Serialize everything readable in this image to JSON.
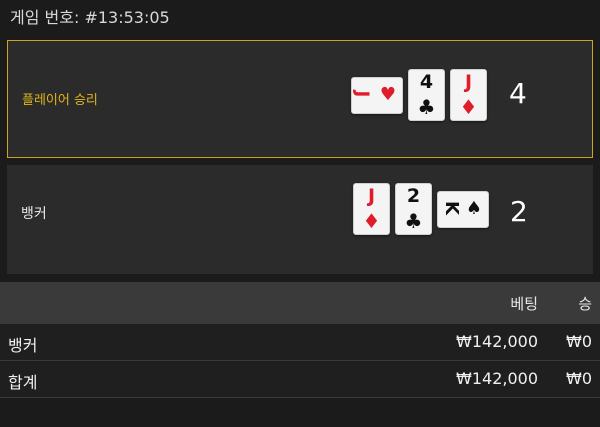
{
  "game_number": "게임 번호: #13:53:05",
  "player": {
    "label": "플레이어 승리",
    "score": "4",
    "cards": [
      {
        "rank": "J",
        "suit": "♥",
        "color": "#e01b2a",
        "orientation": "sideways"
      },
      {
        "rank": "4",
        "suit": "♣",
        "color": "#111111",
        "orientation": "upright"
      },
      {
        "rank": "J",
        "suit": "♦",
        "color": "#e01b2a",
        "orientation": "upright"
      }
    ]
  },
  "banker": {
    "label": "뱅커",
    "score": "2",
    "cards": [
      {
        "rank": "J",
        "suit": "♦",
        "color": "#e01b2a",
        "orientation": "upright"
      },
      {
        "rank": "2",
        "suit": "♣",
        "color": "#111111",
        "orientation": "upright"
      },
      {
        "rank": "K",
        "suit": "♠",
        "color": "#111111",
        "orientation": "sideways"
      }
    ]
  },
  "table": {
    "headers": {
      "bet": "베팅",
      "win": "승"
    },
    "rows": [
      {
        "name": "뱅커",
        "bet": "₩142,000",
        "win": "₩0"
      },
      {
        "name": "합계",
        "bet": "₩142,000",
        "win": "₩0"
      }
    ]
  },
  "colors": {
    "winner_accent": "#c9a51b",
    "red_suit": "#e01b2a"
  }
}
